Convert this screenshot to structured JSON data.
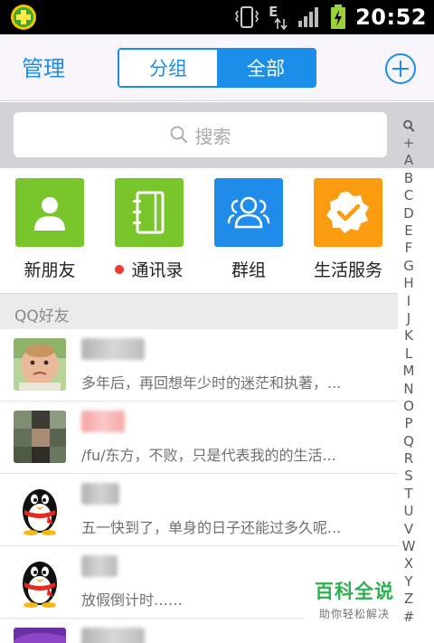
{
  "status_bar": {
    "time": "20:52",
    "network_type": "E"
  },
  "header": {
    "manage_label": "管理",
    "tabs": [
      {
        "label": "分组",
        "active": false
      },
      {
        "label": "全部",
        "active": true
      }
    ],
    "accent_color": "#1a8ee8"
  },
  "search": {
    "placeholder": "搜索"
  },
  "shortcuts": [
    {
      "label": "新朋友",
      "icon": "person-icon",
      "color": "#79c52c"
    },
    {
      "label": "通讯录",
      "icon": "address-book-icon",
      "color": "#79c52c",
      "has_dot": true
    },
    {
      "label": "群组",
      "icon": "group-icon",
      "color": "#1e8ce8"
    },
    {
      "label": "生活服务",
      "icon": "checkmark-badge-icon",
      "color": "#fb9c10"
    }
  ],
  "section": {
    "title": "QQ好友"
  },
  "contacts": [
    {
      "message": "多年后，再回想年少时的迷茫和执著，...",
      "avatar": "baby-photo"
    },
    {
      "message": "/fu/东方，不败，只是代表我的的生活...",
      "avatar": "pixelated-photo"
    },
    {
      "message": "五一快到了，单身的日子还能过多久呢...",
      "avatar": "penguin-avatar"
    },
    {
      "message": "放假倒计时……",
      "avatar": "penguin-avatar"
    }
  ],
  "alpha_index": [
    "+",
    "A",
    "B",
    "C",
    "D",
    "E",
    "F",
    "G",
    "H",
    "I",
    "J",
    "K",
    "L",
    "M",
    "N",
    "O",
    "P",
    "Q",
    "R",
    "S",
    "T",
    "U",
    "V",
    "W",
    "X",
    "Y",
    "Z",
    "#"
  ],
  "watermark": {
    "title": "百科全说",
    "subtitle": "助你轻松解决"
  }
}
